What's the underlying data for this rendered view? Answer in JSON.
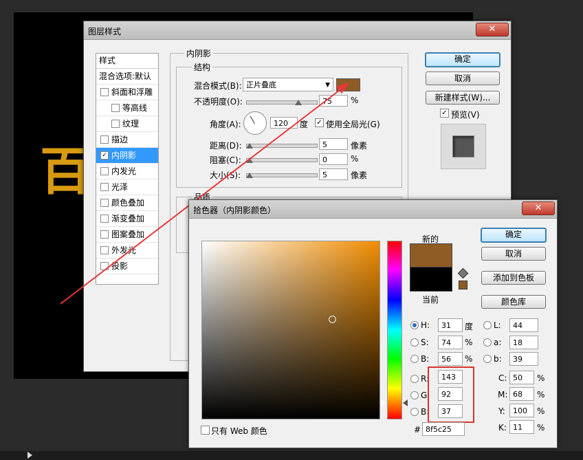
{
  "canvas": {
    "partial_text": "百"
  },
  "layer_style": {
    "title": "图层样式",
    "close": "✕",
    "list_header": "样式",
    "blend_default": "混合选项:默认",
    "items": [
      {
        "label": "斜面和浮雕",
        "checked": false,
        "indent": false
      },
      {
        "label": "等高线",
        "checked": false,
        "indent": true
      },
      {
        "label": "纹理",
        "checked": false,
        "indent": true
      },
      {
        "label": "描边",
        "checked": false,
        "indent": false
      },
      {
        "label": "内阴影",
        "checked": true,
        "indent": false,
        "selected": true
      },
      {
        "label": "内发光",
        "checked": false,
        "indent": false
      },
      {
        "label": "光泽",
        "checked": false,
        "indent": false
      },
      {
        "label": "颜色叠加",
        "checked": false,
        "indent": false
      },
      {
        "label": "渐变叠加",
        "checked": false,
        "indent": false
      },
      {
        "label": "图案叠加",
        "checked": false,
        "indent": false
      },
      {
        "label": "外发光",
        "checked": false,
        "indent": false
      },
      {
        "label": "投影",
        "checked": false,
        "indent": false
      }
    ],
    "section_title": "内阴影",
    "structure_title": "结构",
    "blend_mode_label": "混合模式(B):",
    "blend_mode_value": "正片叠底",
    "blend_color": "#8f5c25",
    "opacity_label": "不透明度(O):",
    "opacity_value": "75",
    "percent": "%",
    "angle_label": "角度(A):",
    "angle_value": "120",
    "degree": "度",
    "global_light_label": "使用全局光(G)",
    "distance_label": "距离(D):",
    "distance_value": "5",
    "choke_label": "阻塞(C):",
    "choke_value": "0",
    "size_label": "大小(S):",
    "size_value": "5",
    "pixels": "像素",
    "quality_title": "品质",
    "ok": "确定",
    "cancel": "取消",
    "new_style": "新建样式(W)...",
    "preview_label": "预览(V)"
  },
  "color_picker": {
    "title": "拾色器（内阴影颜色）",
    "close": "✕",
    "ok": "确定",
    "cancel": "取消",
    "add_swatch": "添加到色板",
    "color_library": "颜色库",
    "new_label": "新的",
    "current_label": "当前",
    "new_color": "#8f5c25",
    "current_color": "#000000",
    "h_label": "H:",
    "h_value": "31",
    "h_unit": "度",
    "s_label": "S:",
    "s_value": "74",
    "s_unit": "%",
    "b_label": "B:",
    "b_value": "56",
    "b_unit": "%",
    "r_label": "R:",
    "r_value": "143",
    "g_label": "G:",
    "g_value": "92",
    "bb_label": "B:",
    "bb_value": "37",
    "l_label": "L:",
    "l_value": "44",
    "a_label": "a:",
    "a_value": "18",
    "lb_label": "b:",
    "lb_value": "39",
    "c_label": "C:",
    "c_value": "50",
    "m_label": "M:",
    "m_value": "68",
    "y_label": "Y:",
    "y_value": "100",
    "k_label": "K:",
    "k_value": "11",
    "pct": "%",
    "hash": "#",
    "hex_value": "8f5c25",
    "web_only": "只有 Web 颜色"
  },
  "colors": {
    "annotation_red": "#e8383a",
    "highlight_box": "#d9342b"
  }
}
